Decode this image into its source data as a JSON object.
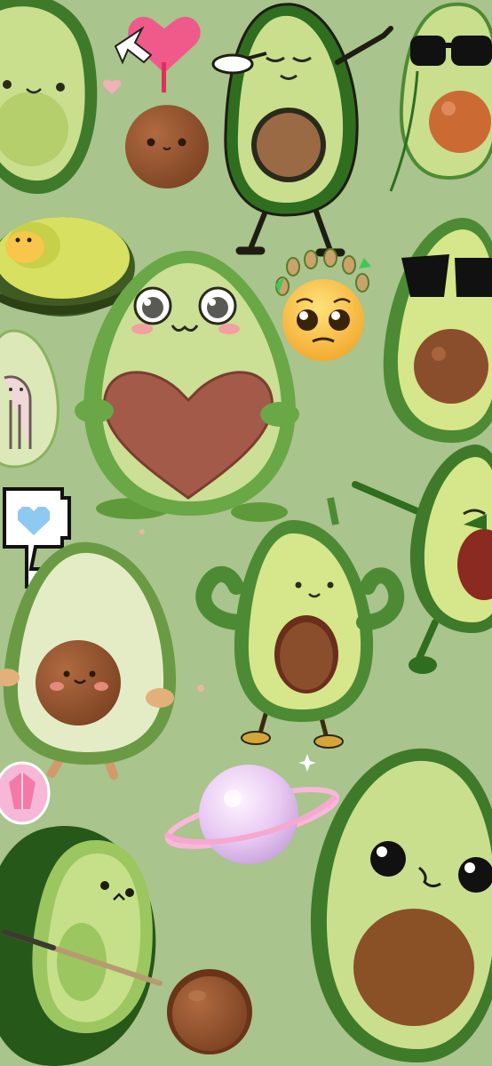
{
  "scene": {
    "kind": "phone-wallpaper",
    "subject": "cute-avocado-stickers",
    "palette": {
      "background": "#a9c48c",
      "avocado_skin": "#3f7a2a",
      "avocado_rim": "#7fb04e",
      "avocado_flesh": "#c9df8e",
      "avocado_flesh_inner": "#b4cf6c",
      "pit": "#8a4e2c",
      "pit_highlight": "#a8643c",
      "cheek": "#f2a0a0",
      "heart": "#a45a48",
      "planet": "#e8c9f2",
      "outline": "#2a2a1c"
    },
    "stickers": [
      "avocado-half-top-left",
      "pixel-heart-cursor",
      "brown-pit-face",
      "dabbing-avocado",
      "sunglasses-avocado-top-right",
      "avocado-half-with-egg-character",
      "heart-hug-avocado",
      "pleading-emoji-with-avocado-crown",
      "sunglasses-avocado-right",
      "small-ghost-avocado-left",
      "pixel-speech-bubble-heart",
      "dancing-avocado-right",
      "flexing-avocado",
      "shy-avocado-left",
      "pink-crystal",
      "pixel-planet",
      "avocado-with-cue-stick",
      "rolling-pit-ball",
      "big-face-avocado-bottom-right"
    ]
  }
}
